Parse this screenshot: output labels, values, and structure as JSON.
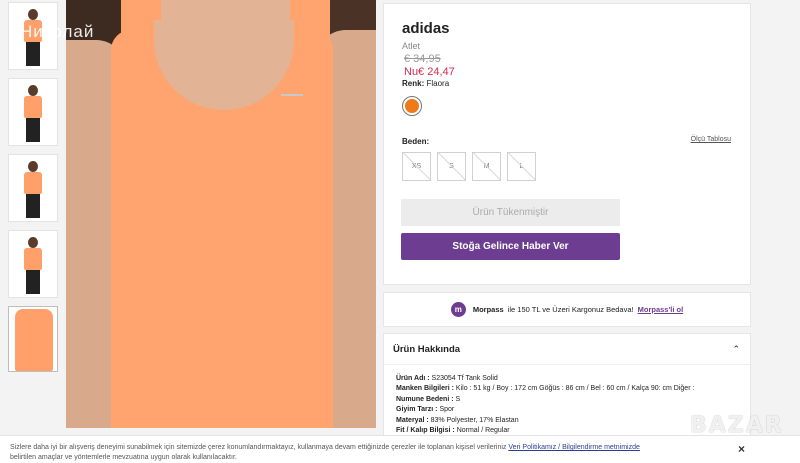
{
  "gallery": {
    "watermark": "Николай",
    "thumbnails": [
      "thumb-1",
      "thumb-2",
      "thumb-3",
      "thumb-4",
      "thumb-5"
    ]
  },
  "product": {
    "brand": "adidas",
    "category": "Atlet",
    "old_price": "€ 34,95",
    "new_price": "Nu€ 24,47",
    "color_label": "Renk:",
    "color_value": "Flaora",
    "swatch_color": "#ef7a1a",
    "size_label": "Beden:",
    "size_guide": "Ölçü Tablosu",
    "sizes": [
      "XS",
      "S",
      "M",
      "L"
    ],
    "out_of_stock_label": "Ürün Tükenmiştir",
    "notify_label": "Stoğa Gelince Haber Ver"
  },
  "morpass": {
    "icon_letter": "m",
    "brand": "Morpass",
    "text": "ile 150 TL ve Üzeri Kargonuz Bedava!",
    "link": "Morpass'li ol"
  },
  "about": {
    "title": "Ürün Hakkında",
    "specs": [
      {
        "label": "Ürün Adı :",
        "value": "S23054 Tf Tank Solid"
      },
      {
        "label": "Manken Bilgileri :",
        "value": "Kilo : 51 kg / Boy : 172 cm Göğüs : 86 cm / Bel : 60 cm / Kalça 90: cm Diğer :"
      },
      {
        "label": "Numune Bedeni :",
        "value": "S"
      },
      {
        "label": "Giyim Tarzı :",
        "value": "Spor"
      },
      {
        "label": "Materyal :",
        "value": "83% Polyester, 17% Elastan"
      },
      {
        "label": "Fit / Kalıp Bilgisi :",
        "value": "Normal / Regular"
      }
    ]
  },
  "cookie": {
    "text1": "Sizlere daha iyi bir alışveriş deneyimi sunabilmek için sitemizde çerez konumlandırmaktayız, kullanmaya devam ettiğinizde çerezler ile toplanan kişisel verileriniz",
    "policy_link": "Veri Politikamız / Bilgilendirme metnimizde",
    "text2": "belirtilen amaçlar ve yöntemlerle mevzuatına uygun olarak kullanılacaktır.",
    "close": "×"
  },
  "overlay": {
    "bazar": "BAZAR"
  },
  "colors": {
    "accent": "#6c3d91",
    "price": "#d02c4f",
    "tank": "#ffa46e"
  }
}
